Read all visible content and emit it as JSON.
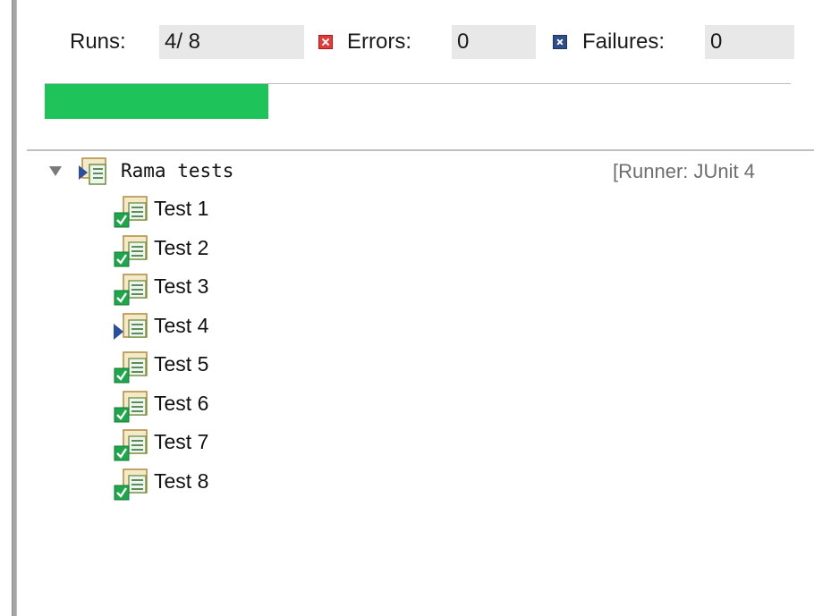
{
  "counters": {
    "runs_label": "Runs:",
    "runs_value": "4/ 8",
    "errors_label": "Errors:",
    "errors_value": "0",
    "failures_label": "Failures:",
    "failures_value": "0"
  },
  "progress": {
    "completed": 4,
    "total": 8,
    "fraction": 0.3,
    "color": "#1ec45a"
  },
  "tree": {
    "root": {
      "label": "Rama tests",
      "runner": "[Runner: JUnit 4",
      "expanded": true,
      "status": "running"
    },
    "items": [
      {
        "label": "Test 1",
        "status": "passed"
      },
      {
        "label": "Test 2",
        "status": "passed"
      },
      {
        "label": "Test 3",
        "status": "passed"
      },
      {
        "label": "Test 4",
        "status": "running"
      },
      {
        "label": "Test 5",
        "status": "passed"
      },
      {
        "label": "Test 6",
        "status": "passed"
      },
      {
        "label": "Test 7",
        "status": "passed"
      },
      {
        "label": "Test 8",
        "status": "passed"
      }
    ]
  },
  "icons": {
    "errors": "error-x-icon",
    "failures": "failure-x-icon",
    "suite": "test-suite-running-icon",
    "passed": "test-passed-icon",
    "running": "test-running-icon"
  },
  "colors": {
    "progress_green": "#1ec45a",
    "error_red": "#e13a3a",
    "failure_blue": "#2f4d8a",
    "check_green": "#1ea64a",
    "running_blue": "#2a4ea0"
  }
}
